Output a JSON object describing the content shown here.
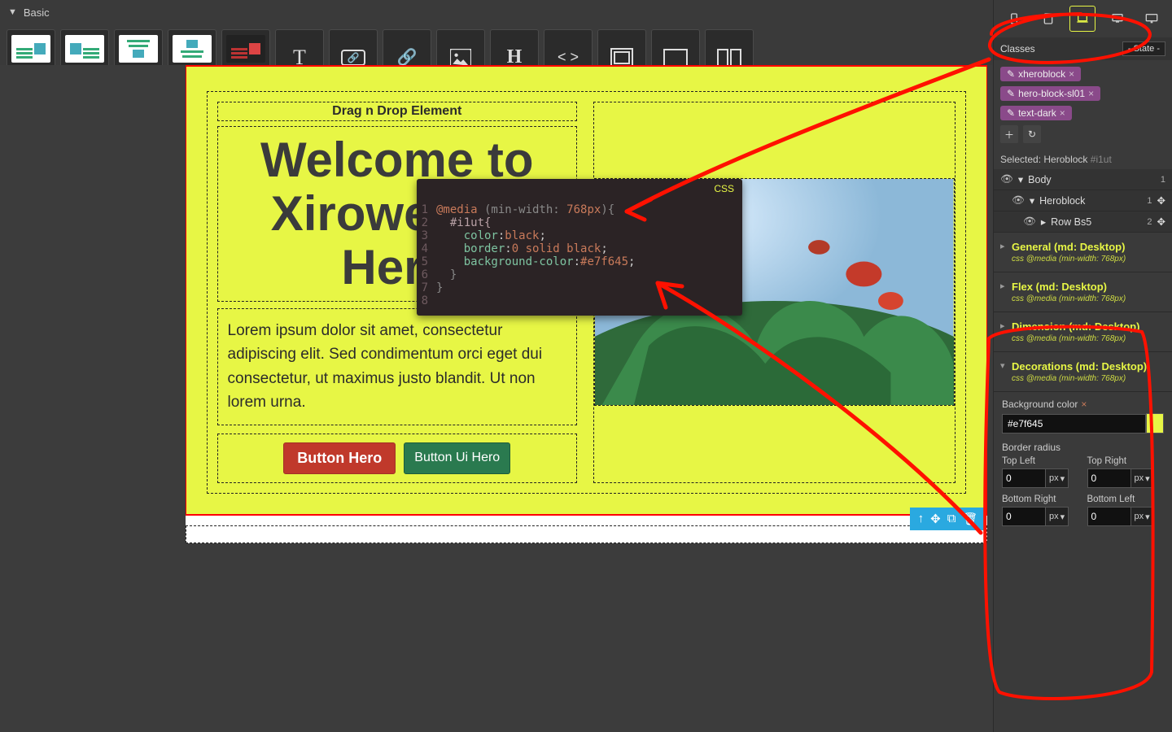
{
  "topbar": {
    "title": "Basic",
    "css_label": "CSS"
  },
  "shelf": [
    {
      "label": "Text Left, Img R"
    },
    {
      "label": "Image Left,Text"
    },
    {
      "label": "Text top, Image"
    },
    {
      "label": "Image Top, Text"
    },
    {
      "label": "Text Left, Img R"
    },
    {
      "label": "Text"
    },
    {
      "label": "Link Button"
    },
    {
      "label": "Link"
    },
    {
      "label": "Image"
    },
    {
      "label": "H1 - H6"
    },
    {
      "label": "DIV"
    },
    {
      "label": "Row"
    },
    {
      "label": "1 Column"
    },
    {
      "label": "2 Column"
    }
  ],
  "hero": {
    "drag_text": "Drag n Drop Element",
    "title": "Welcome to Xiroweb Ui Hero",
    "para": "Lorem ipsum dolor sit amet, consectetur adipiscing elit. Sed condimentum orci eget dui consectetur, ut maximus justo blandit. Ut non lorem urna.",
    "btn_a": "Button Hero",
    "btn_b": "Button Ui Hero"
  },
  "code": {
    "l1_a": "@media",
    "l1_b": " (min-width: ",
    "l1_c": "768px",
    "l1_d": "){",
    "l2": "  #i1ut{",
    "l3_a": "    color",
    "l3_b": ":",
    "l3_c": "black",
    "l3_d": ";",
    "l4_a": "    border",
    "l4_b": ":",
    "l4_c": "0 solid black",
    "l4_d": ";",
    "l5_a": "    background-color",
    "l5_b": ":",
    "l5_c": "#e7f645",
    "l5_d": ";",
    "l6": "  }",
    "l7": "}"
  },
  "right": {
    "classes_label": "Classes",
    "state_label": "- State -",
    "tags": [
      "xheroblock",
      "hero-block-sl01",
      "text-dark"
    ],
    "selected_label": "Selected:",
    "selected_name": "Heroblock",
    "selected_id": "#i1ut",
    "tree": [
      {
        "name": "Body",
        "count": "1",
        "indent": 0,
        "caret": "▾"
      },
      {
        "name": "Heroblock",
        "count": "1",
        "indent": 1,
        "caret": "▾",
        "move": true
      },
      {
        "name": "Row Bs5",
        "count": "2",
        "indent": 2,
        "caret": "▸",
        "move": true
      }
    ],
    "acc": [
      {
        "title": "General (md: Desktop)",
        "sub": "css @media (min-width: 768px)"
      },
      {
        "title": "Flex (md: Desktop)",
        "sub": "css @media (min-width: 768px)"
      },
      {
        "title": "Dimension (md: Desktop)",
        "sub": "css @media (min-width: 768px)"
      },
      {
        "title": "Decorations (md: Desktop)",
        "sub": "css @media (min-width: 768px)"
      }
    ],
    "deco": {
      "bg_label": "Background color",
      "bg_value": "#e7f645",
      "radius_label": "Border radius",
      "corners": {
        "tl_label": "Top Left",
        "tr_label": "Top Right",
        "br_label": "Bottom Right",
        "bl_label": "Bottom Left",
        "tl": "0",
        "tr": "0",
        "br": "0",
        "bl": "0",
        "unit": "px"
      }
    }
  }
}
